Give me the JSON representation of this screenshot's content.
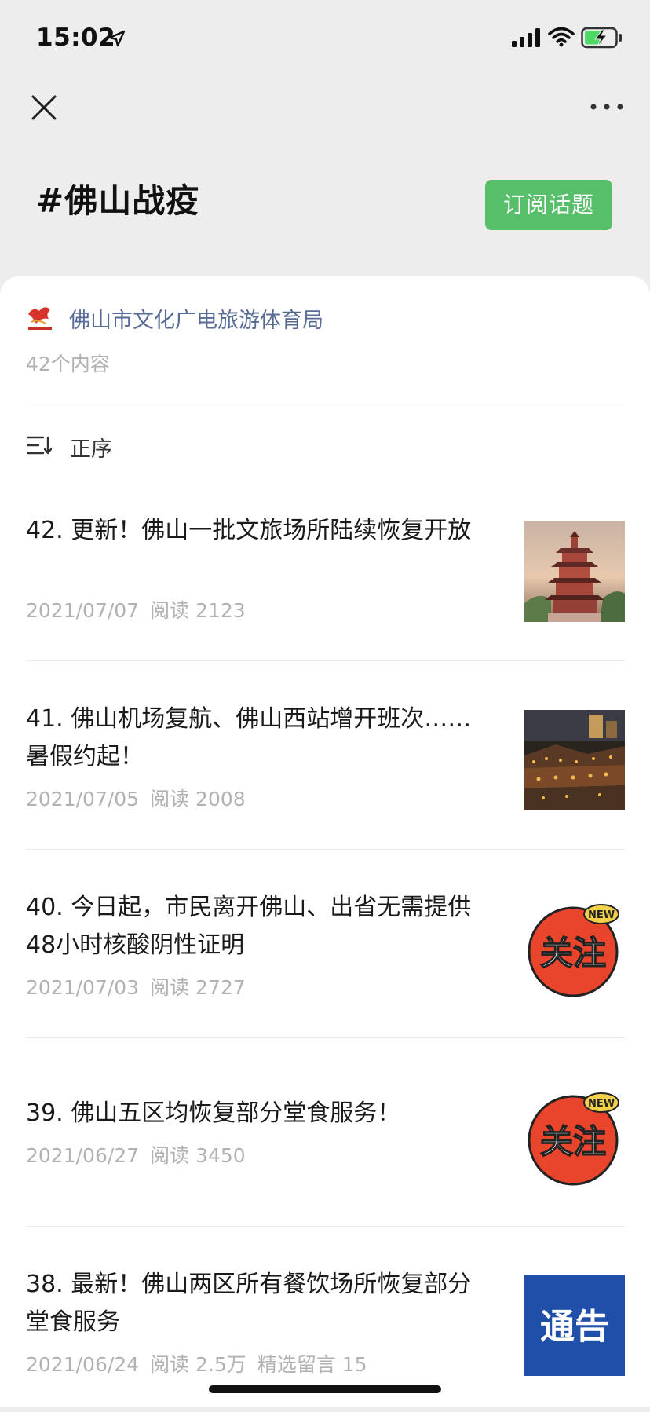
{
  "status_bar": {
    "time": "15:02"
  },
  "topic": {
    "title": "#佛山战疫",
    "subscribe_label": "订阅话题"
  },
  "author": {
    "name": "佛山市文化广电旅游体育局",
    "count": "42个内容"
  },
  "sort": {
    "label": "正序"
  },
  "articles": [
    {
      "title": "42. 更新！佛山一批文旅场所陆续恢复开放",
      "date": "2021/07/07",
      "reads": "阅读 2123",
      "extra": "",
      "thumb": "pagoda"
    },
    {
      "title": "41. 佛山机场复航、佛山西站增开班次……暑假约起！",
      "date": "2021/07/05",
      "reads": "阅读 2008",
      "extra": "",
      "thumb": "night-town"
    },
    {
      "title": "40. 今日起，市民离开佛山、出省无需提供48小时核酸阴性证明",
      "date": "2021/07/03",
      "reads": "阅读 2727",
      "extra": "",
      "thumb": "badge"
    },
    {
      "title": "39. 佛山五区均恢复部分堂食服务！",
      "date": "2021/06/27",
      "reads": "阅读 3450",
      "extra": "",
      "thumb": "badge"
    },
    {
      "title": "38. 最新！佛山两区所有餐饮场所恢复部分堂食服务",
      "date": "2021/06/24",
      "reads": "阅读 2.5万",
      "extra": "精选留言 15",
      "thumb": "notice"
    }
  ],
  "badge": {
    "main": "关注",
    "tag": "NEW"
  },
  "notice": {
    "text": "通告"
  },
  "colors": {
    "accent": "#57be6a",
    "link": "#576b95",
    "meta": "#b2b2b2",
    "badge": "#e8452c"
  }
}
